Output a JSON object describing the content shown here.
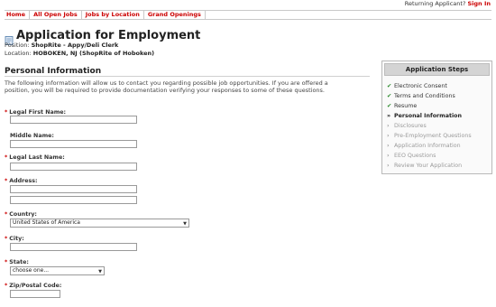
{
  "header": {
    "returning_text": "Returning Applicant?",
    "sign_in_label": "Sign In"
  },
  "nav": {
    "items": [
      "Home",
      "All Open Jobs",
      "Jobs by Location",
      "Grand Openings"
    ]
  },
  "page": {
    "title": "Application for Employment",
    "position_label": "Position:",
    "position_value": "ShopRite - Appy/Deli Clerk",
    "location_label": "Location:",
    "location_value": "HOBOKEN, NJ  (ShopRite of Hoboken)"
  },
  "personal_info": {
    "heading": "Personal Information",
    "intro": "The following information will allow us to contact you regarding possible job opportunities. If you are offered a position, you will be required to provide documentation verifying your responses to some of these questions.",
    "fields": {
      "first_name": "Legal First Name:",
      "middle_name": "Middle Name:",
      "last_name": "Legal Last Name:",
      "address": "Address:",
      "country": "Country:",
      "country_value": "United States of America",
      "city": "City:",
      "state": "State:",
      "state_value": "choose one...",
      "zip": "Zip/Postal Code:"
    },
    "required_marker": "*"
  },
  "steps": {
    "title": "Application Steps",
    "items": [
      {
        "label": "Electronic Consent",
        "status": "done",
        "mark": "✔"
      },
      {
        "label": "Terms and Conditions",
        "status": "done",
        "mark": "✔"
      },
      {
        "label": "Resume",
        "status": "done",
        "mark": "✔"
      },
      {
        "label": "Personal Information",
        "status": "current",
        "mark": "»"
      },
      {
        "label": "Disclosures",
        "status": "pending",
        "mark": "›"
      },
      {
        "label": "Pre-Employment Questions",
        "status": "pending",
        "mark": "›"
      },
      {
        "label": "Application Information",
        "status": "pending",
        "mark": "›"
      },
      {
        "label": "EEO Questions",
        "status": "pending",
        "mark": "›"
      },
      {
        "label": "Review Your Application",
        "status": "pending",
        "mark": "›"
      }
    ]
  },
  "colors": {
    "accent": "#cc0000",
    "done": "#2a8a2a",
    "pending": "#9a9a9a"
  }
}
